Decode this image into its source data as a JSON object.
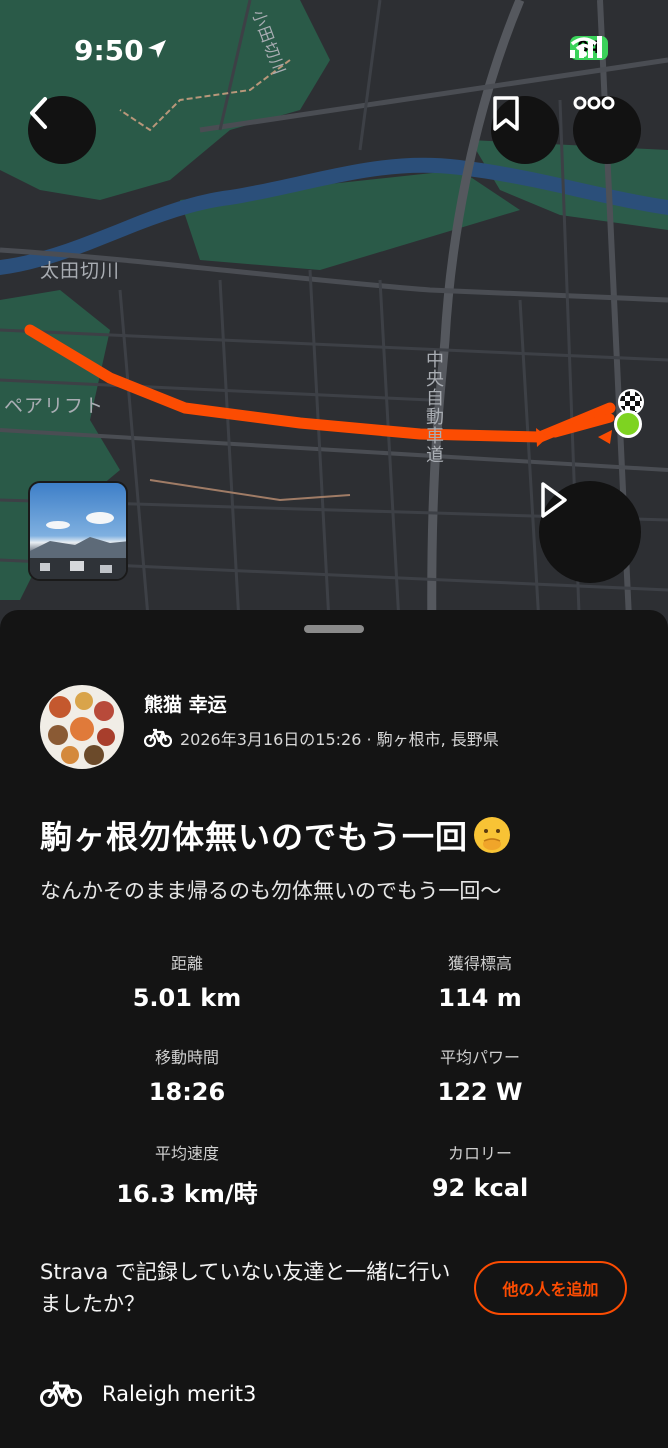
{
  "status_bar": {
    "time": "9:50",
    "battery": "94"
  },
  "map": {
    "labels": {
      "river": "太田切川",
      "river_top": "小田切川",
      "highway": "中央自動車道",
      "place": "ペアリフト"
    },
    "route_color": "#fc4c02",
    "start_color": "#7ed321"
  },
  "activity": {
    "athlete_name": "熊猫 幸运",
    "meta": "2026年3月16日の15:26 · 駒ヶ根市, 長野県",
    "title": "駒ヶ根勿体無いのでもう一回",
    "title_emoji": "hand-over-mouth-emoji",
    "description": "なんかそのまま帰るのも勿体無いのでもう一回〜"
  },
  "stats": [
    {
      "label": "距離",
      "value": "5.01 km"
    },
    {
      "label": "獲得標高",
      "value": "114 m"
    },
    {
      "label": "移動時間",
      "value": "18:26"
    },
    {
      "label": "平均パワー",
      "value": "122 W"
    },
    {
      "label": "平均速度",
      "value": "16.3 km/時"
    },
    {
      "label": "カロリー",
      "value": "92 kcal"
    }
  ],
  "friends": {
    "prompt": "Strava で記録していない友達と一緒に行いましたか？",
    "button": "他の人を追加"
  },
  "gear": {
    "name": "Raleigh merit3"
  },
  "colors": {
    "accent": "#fc4c02",
    "background": "#141414"
  }
}
